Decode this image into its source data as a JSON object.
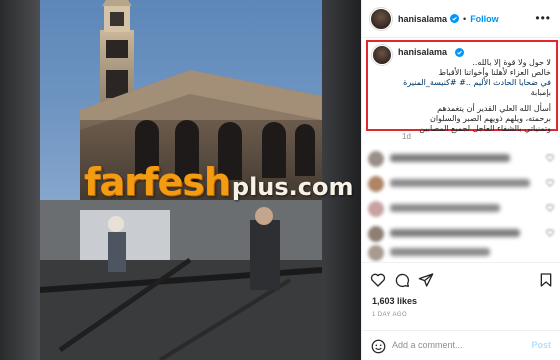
{
  "post": {
    "username": "hanisalama",
    "follow_label": "Follow",
    "more_label": "•••",
    "dot": "•",
    "caption": {
      "username": "hanisalama",
      "lines": [
        "لا حول ولا قوة إلا بالله..",
        "خالص العزاء لأهلنا وأخواتنا الأقباط",
        "في ضحايا الحادث الأليم ..# #كنيسة_المنيرة",
        "بإمبابة",
        "",
        "أسأل الله العلي القدير أن يتغمدهم",
        "برحمته، ويلهم ذويهم الصبر والسلوان",
        "وتمنياتي بالشفاء العاجل لجميع المصابين"
      ]
    },
    "time_ago": "1d",
    "likes": "1,603 likes",
    "date": "1 DAY AGO",
    "comment_placeholder": "Add a comment...",
    "post_label": "Post"
  },
  "watermark": {
    "main": "farfesh",
    "sub": "plus.com"
  },
  "colors": {
    "accent": "#0095f6",
    "highlight_border": "#e0282e",
    "watermark_orange": "#f39c12"
  },
  "icons": {
    "verified": "verified-badge-icon",
    "more": "more-options-icon",
    "like": "heart-icon",
    "comment": "comment-icon",
    "share": "send-icon",
    "save": "bookmark-icon",
    "emoji": "emoji-icon"
  }
}
